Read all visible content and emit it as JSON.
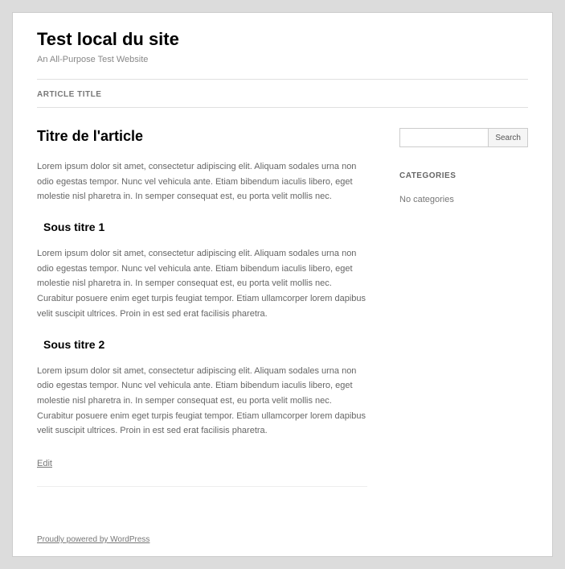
{
  "header": {
    "site_title": "Test local du site",
    "tagline": "An All-Purpose Test Website"
  },
  "nav": {
    "item": "ARTICLE TITLE"
  },
  "article": {
    "title": "Titre de l'article",
    "p1": "Lorem ipsum dolor sit amet, consectetur adipiscing elit. Aliquam sodales urna non odio egestas tempor. Nunc vel vehicula ante. Etiam bibendum iaculis libero, eget molestie nisl pharetra in. In semper consequat est, eu porta velit mollis nec.",
    "sub1": "Sous titre 1",
    "p2": "Lorem ipsum dolor sit amet, consectetur adipiscing elit. Aliquam sodales urna non odio egestas tempor. Nunc vel vehicula ante. Etiam bibendum iaculis libero, eget molestie nisl pharetra in. In semper consequat est, eu porta velit mollis nec. Curabitur posuere enim eget turpis feugiat tempor. Etiam ullamcorper lorem dapibus velit suscipit ultrices. Proin in est sed erat facilisis pharetra.",
    "sub2": "Sous titre 2",
    "p3": "Lorem ipsum dolor sit amet, consectetur adipiscing elit. Aliquam sodales urna non odio egestas tempor. Nunc vel vehicula ante. Etiam bibendum iaculis libero, eget molestie nisl pharetra in. In semper consequat est, eu porta velit mollis nec. Curabitur posuere enim eget turpis feugiat tempor. Etiam ullamcorper lorem dapibus velit suscipit ultrices. Proin in est sed erat facilisis pharetra.",
    "edit": "Edit"
  },
  "sidebar": {
    "search_button": "Search",
    "categories_title": "CATEGORIES",
    "categories_empty": "No categories"
  },
  "footer": {
    "credit": "Proudly powered by WordPress"
  }
}
